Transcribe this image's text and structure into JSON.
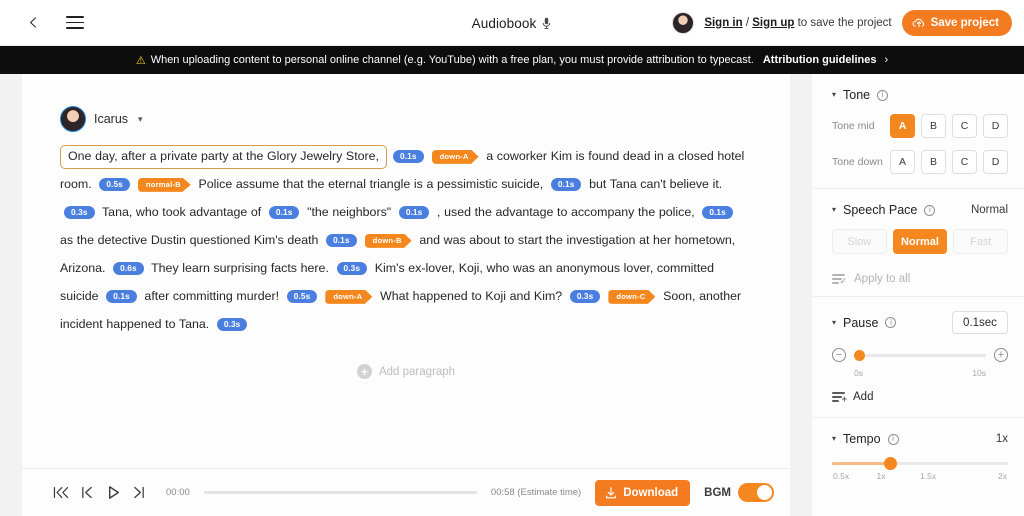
{
  "topbar": {
    "back_icon": "chevron-left-icon",
    "menu_icon": "hamburger-menu-icon",
    "title": "Audiobook",
    "title_icon": "microphone-icon",
    "signin_label": "Sign in",
    "separator": " / ",
    "signup_label": "Sign up",
    "signin_suffix": " to save the project",
    "save_label": "Save project",
    "save_icon": "cloud-upload-icon",
    "accent_color": "#f47b20"
  },
  "notice": {
    "warn_icon": "warning-triangle-icon",
    "text": "When uploading content to personal online channel (e.g. YouTube) with a free plan, you must provide attribution to typecast.",
    "link_label": "Attribution guidelines",
    "chevron": "›",
    "background": "#0d0d0d",
    "warn_color": "#ffd21e"
  },
  "editor": {
    "speaker": {
      "name": "Icarus",
      "caret": "▾",
      "avatar": "speaker-avatar"
    },
    "add_paragraph_label": "Add paragraph",
    "selected_sentence": "One day, after a private party at the Glory Jewelry Store,",
    "script_tokens": [
      {
        "t": "pill",
        "v": "0.1s"
      },
      {
        "t": "tag",
        "v": "down-A"
      },
      {
        "t": "text",
        "v": "a coworker Kim is found dead in a closed hotel room."
      },
      {
        "t": "pill",
        "v": "0.5s"
      },
      {
        "t": "tag",
        "v": "normal-B"
      },
      {
        "t": "text",
        "v": "Police assume that the eternal triangle is a pessimistic suicide,"
      },
      {
        "t": "pill",
        "v": "0.1s"
      },
      {
        "t": "text",
        "v": "but Tana can't believe it."
      },
      {
        "t": "pill",
        "v": "0.3s"
      },
      {
        "t": "text",
        "v": "Tana, who took advantage of"
      },
      {
        "t": "pill",
        "v": "0.1s"
      },
      {
        "t": "text",
        "v": "\"the neighbors\""
      },
      {
        "t": "pill",
        "v": "0.1s"
      },
      {
        "t": "text",
        "v": ", used the advantage to accompany the police,"
      },
      {
        "t": "pill",
        "v": "0.1s"
      },
      {
        "t": "text",
        "v": "as the detective Dustin questioned Kim's death"
      },
      {
        "t": "pill",
        "v": "0.1s"
      },
      {
        "t": "tag",
        "v": "down-B"
      },
      {
        "t": "text",
        "v": "and was about to start the investigation at her hometown, Arizona."
      },
      {
        "t": "pill",
        "v": "0.6s"
      },
      {
        "t": "text",
        "v": "They learn surprising facts here."
      },
      {
        "t": "pill",
        "v": "0.3s"
      },
      {
        "t": "text",
        "v": "Kim's ex-lover, Koji, who was an anonymous lover, committed suicide"
      },
      {
        "t": "pill",
        "v": "0.1s"
      },
      {
        "t": "text",
        "v": "after committing murder!"
      },
      {
        "t": "pill",
        "v": "0.5s"
      },
      {
        "t": "tag",
        "v": "down-A"
      },
      {
        "t": "text",
        "v": "What happened to Koji and Kim?"
      },
      {
        "t": "pill",
        "v": "0.3s"
      },
      {
        "t": "tag",
        "v": "down-C"
      },
      {
        "t": "text",
        "v": "Soon, another incident happened to Tana."
      },
      {
        "t": "pill",
        "v": "0.3s"
      }
    ]
  },
  "player": {
    "first_icon": "skip-to-start-icon",
    "prev_icon": "previous-icon",
    "play_icon": "play-icon",
    "next_icon": "next-icon",
    "current_time": "00:00",
    "estimate_time": "00:58 (Estimate time)",
    "download_label": "Download",
    "download_icon": "download-icon",
    "bgm_label": "BGM",
    "bgm_enabled": true,
    "progress_percent": 0
  },
  "sidebar": {
    "tone": {
      "title": "Tone",
      "info_icon": "info-icon",
      "caret": "▾",
      "rows": [
        {
          "label": "Tone mid",
          "options": [
            "A",
            "B",
            "C",
            "D"
          ],
          "selected": "A"
        },
        {
          "label": "Tone down",
          "options": [
            "A",
            "B",
            "C",
            "D"
          ],
          "selected": ""
        }
      ]
    },
    "speech_pace": {
      "title": "Speech Pace",
      "info_icon": "info-icon",
      "caret": "▾",
      "value": "Normal",
      "options": [
        "Slow",
        "Normal",
        "Fast"
      ],
      "selected": "Normal"
    },
    "apply_to_all": {
      "label": "Apply to all",
      "icon": "apply-to-all-icon"
    },
    "pause": {
      "title": "Pause",
      "info_icon": "info-icon",
      "caret": "▾",
      "value": "0.1sec",
      "minus_icon": "minus-circle-icon",
      "plus_icon": "plus-circle-icon",
      "min_label": "0s",
      "max_label": "10s",
      "knob_percent": 4,
      "add_label": "Add",
      "add_icon": "add-pause-icon"
    },
    "tempo": {
      "title": "Tempo",
      "info_icon": "info-icon",
      "caret": "▾",
      "value": "1x",
      "ticks": [
        "0.5x",
        "1x",
        "1.5x",
        "2x"
      ],
      "knob_percent": 33
    }
  }
}
